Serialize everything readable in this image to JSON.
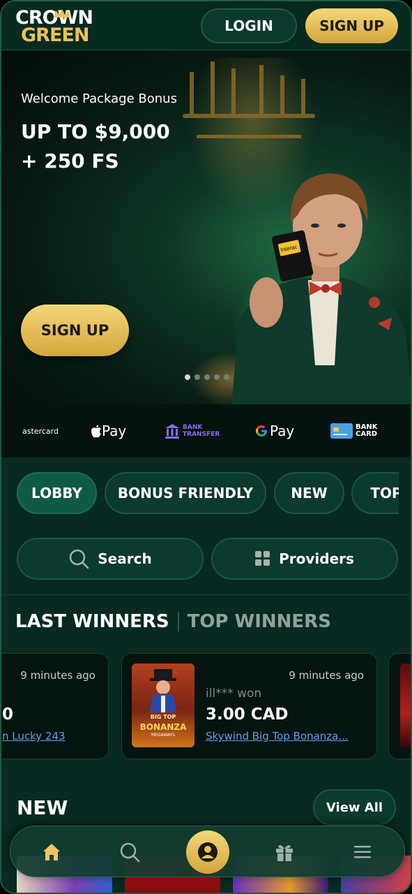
{
  "header": {
    "logo_line1": "CROWN",
    "logo_line2": "GREEN",
    "login_label": "LOGIN",
    "signup_label": "SIGN UP"
  },
  "hero": {
    "subtitle": "Welcome Package Bonus",
    "title_line1": "UP TO $9,000",
    "title_line2": "+ 250 FS",
    "button_label": "SIGN UP",
    "card_text": "Interac",
    "slides_total": 5,
    "active_slide": 1
  },
  "payments": {
    "mastercard": "astercard",
    "applepay": "Pay",
    "bank_transfer_line1": "BANK",
    "bank_transfer_line2": "TRANSFER",
    "googlepay": "Pay",
    "bank_card_line1": "BANK",
    "bank_card_line2": "CARD"
  },
  "tabs": [
    {
      "label": "LOBBY",
      "active": true
    },
    {
      "label": "BONUS FRIENDLY",
      "active": false
    },
    {
      "label": "NEW",
      "active": false
    },
    {
      "label": "TOP",
      "active": false
    }
  ],
  "search": {
    "label": "Search"
  },
  "providers": {
    "label": "Providers"
  },
  "winners": {
    "tab_last": "LAST WINNERS",
    "tab_top": "TOP WINNERS",
    "cards": [
      {
        "time": "9 minutes ago",
        "amount": "0",
        "game": "n Lucky 243"
      },
      {
        "time": "9 minutes ago",
        "user": "ill*** won",
        "amount": "3.00 CAD",
        "game": "Skywind Big Top Bonanza...",
        "thumb_line1": "BIG TOP",
        "thumb_line2": "BONANZA",
        "thumb_line3": "MEGAWAYS"
      }
    ]
  },
  "new_section": {
    "title": "NEW",
    "view_all": "View All"
  },
  "colors": {
    "background": "#07221b",
    "gold": "#e9c25c",
    "pill": "#0b3a2e",
    "link": "#5f9cf2"
  },
  "bottom_nav": {
    "icons": [
      "home-icon",
      "search-icon",
      "user-icon",
      "gift-icon",
      "menu-icon"
    ]
  }
}
